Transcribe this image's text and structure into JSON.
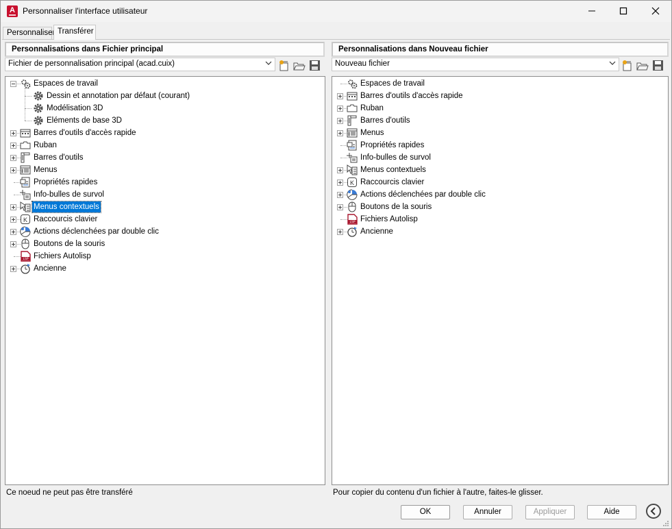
{
  "window": {
    "title": "Personnaliser l'interface utilisateur",
    "minimize_glyph": "—",
    "maximize_glyph": "☐",
    "close_glyph": "✕"
  },
  "tabs": [
    {
      "label": "Personnaliser",
      "active": false
    },
    {
      "label": "Transférer",
      "active": true
    }
  ],
  "left": {
    "header": "Personnalisations dans Fichier principal",
    "combo_value": "Fichier de personnalisation principal (acad.cuix)",
    "status": "Ce noeud ne peut pas être transféré",
    "tree": [
      {
        "label": "Espaces de travail",
        "icon": "workspaces-icon",
        "level": 0,
        "expander": "minus",
        "selected": false
      },
      {
        "label": "Dessin et annotation par défaut (courant)",
        "icon": "gear-icon",
        "level": 1,
        "expander": "none",
        "selected": false
      },
      {
        "label": "Modélisation 3D",
        "icon": "gear-icon",
        "level": 1,
        "expander": "none",
        "selected": false
      },
      {
        "label": "Eléments de base 3D",
        "icon": "gear-icon",
        "level": 1,
        "expander": "none",
        "selected": false
      },
      {
        "label": "Barres d'outils d'accès rapide",
        "icon": "quick-access-toolbar-icon",
        "level": 0,
        "expander": "plus",
        "selected": false
      },
      {
        "label": "Ruban",
        "icon": "ribbon-icon",
        "level": 0,
        "expander": "plus",
        "selected": false
      },
      {
        "label": "Barres d'outils",
        "icon": "toolbars-icon",
        "level": 0,
        "expander": "plus",
        "selected": false
      },
      {
        "label": "Menus",
        "icon": "menus-icon",
        "level": 0,
        "expander": "plus",
        "selected": false
      },
      {
        "label": "Propriétés rapides",
        "icon": "quick-properties-icon",
        "level": 0,
        "expander": "none",
        "selected": false
      },
      {
        "label": "Info-bulles de survol",
        "icon": "rollover-tooltips-icon",
        "level": 0,
        "expander": "none",
        "selected": false
      },
      {
        "label": "Menus contextuels",
        "icon": "shortcut-menus-icon",
        "level": 0,
        "expander": "plus",
        "selected": true
      },
      {
        "label": "Raccourcis clavier",
        "icon": "keyboard-shortcuts-icon",
        "level": 0,
        "expander": "plus",
        "selected": false
      },
      {
        "label": "Actions déclenchées par double clic",
        "icon": "double-click-actions-icon",
        "level": 0,
        "expander": "plus",
        "selected": false
      },
      {
        "label": "Boutons de la souris",
        "icon": "mouse-buttons-icon",
        "level": 0,
        "expander": "plus",
        "selected": false
      },
      {
        "label": "Fichiers Autolisp",
        "icon": "autolisp-files-icon",
        "level": 0,
        "expander": "none",
        "selected": false
      },
      {
        "label": "Ancienne",
        "icon": "legacy-icon",
        "level": 0,
        "expander": "plus",
        "selected": false
      }
    ]
  },
  "right": {
    "header": "Personnalisations dans Nouveau fichier",
    "combo_value": "Nouveau fichier",
    "status": "Pour copier du contenu d'un fichier à l'autre, faites-le glisser.",
    "tree": [
      {
        "label": "Espaces de travail",
        "icon": "workspaces-icon",
        "level": 0,
        "expander": "none",
        "selected": false
      },
      {
        "label": "Barres d'outils d'accès rapide",
        "icon": "quick-access-toolbar-icon",
        "level": 0,
        "expander": "plus",
        "selected": false
      },
      {
        "label": "Ruban",
        "icon": "ribbon-icon",
        "level": 0,
        "expander": "plus",
        "selected": false
      },
      {
        "label": "Barres d'outils",
        "icon": "toolbars-icon",
        "level": 0,
        "expander": "plus",
        "selected": false
      },
      {
        "label": "Menus",
        "icon": "menus-icon",
        "level": 0,
        "expander": "plus",
        "selected": false
      },
      {
        "label": "Propriétés rapides",
        "icon": "quick-properties-icon",
        "level": 0,
        "expander": "none",
        "selected": false
      },
      {
        "label": "Info-bulles de survol",
        "icon": "rollover-tooltips-icon",
        "level": 0,
        "expander": "none",
        "selected": false
      },
      {
        "label": "Menus contextuels",
        "icon": "shortcut-menus-icon",
        "level": 0,
        "expander": "plus",
        "selected": false
      },
      {
        "label": "Raccourcis clavier",
        "icon": "keyboard-shortcuts-icon",
        "level": 0,
        "expander": "plus",
        "selected": false
      },
      {
        "label": "Actions déclenchées par double clic",
        "icon": "double-click-actions-icon",
        "level": 0,
        "expander": "plus",
        "selected": false
      },
      {
        "label": "Boutons de la souris",
        "icon": "mouse-buttons-icon",
        "level": 0,
        "expander": "plus",
        "selected": false
      },
      {
        "label": "Fichiers Autolisp",
        "icon": "autolisp-files-icon",
        "level": 0,
        "expander": "none",
        "selected": false
      },
      {
        "label": "Ancienne",
        "icon": "legacy-icon",
        "level": 0,
        "expander": "plus",
        "selected": false
      }
    ]
  },
  "buttons": {
    "ok": "OK",
    "cancel": "Annuler",
    "apply": "Appliquer",
    "help": "Aide",
    "apply_enabled": false
  },
  "colors": {
    "selection": "#0078d7",
    "autolisp": "#a8162e",
    "accent_blue": "#3a7bd5",
    "new_star": "#e8a317"
  }
}
